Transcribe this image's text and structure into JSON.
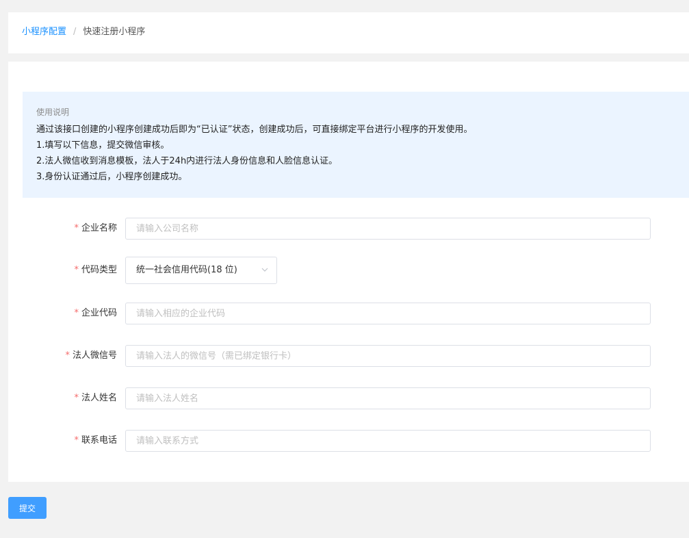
{
  "breadcrumb": {
    "parent": "小程序配置",
    "separator": "/",
    "current": "快速注册小程序"
  },
  "notice": {
    "title": "使用说明",
    "lines": [
      "通过该接口创建的小程序创建成功后即为“已认证”状态，创建成功后，可直接绑定平台进行小程序的开发使用。",
      "1.填写以下信息，提交微信审核。",
      "2.法人微信收到消息模板，法人于24h内进行法人身份信息和人脸信息认证。",
      "3.身份认证通过后，小程序创建成功。"
    ]
  },
  "form": {
    "required_mark": "*",
    "company_name": {
      "label": "企业名称",
      "placeholder": "请输入公司名称",
      "value": ""
    },
    "code_type": {
      "label": "代码类型",
      "value": "统一社会信用代码(18 位)"
    },
    "company_code": {
      "label": "企业代码",
      "placeholder": "请输入相应的企业代码",
      "value": ""
    },
    "legal_wechat": {
      "label": "法人微信号",
      "placeholder": "请输入法人的微信号（需已绑定银行卡）",
      "value": ""
    },
    "legal_name": {
      "label": "法人姓名",
      "placeholder": "请输入法人姓名",
      "value": ""
    },
    "contact_phone": {
      "label": "联系电话",
      "placeholder": "请输入联系方式",
      "value": ""
    }
  },
  "actions": {
    "submit_label": "提交"
  },
  "colors": {
    "accent": "#409eff",
    "link": "#1890ff",
    "required": "#f56c6c",
    "notice_bg": "#ebf4ff",
    "page_bg": "#f2f2f2"
  }
}
